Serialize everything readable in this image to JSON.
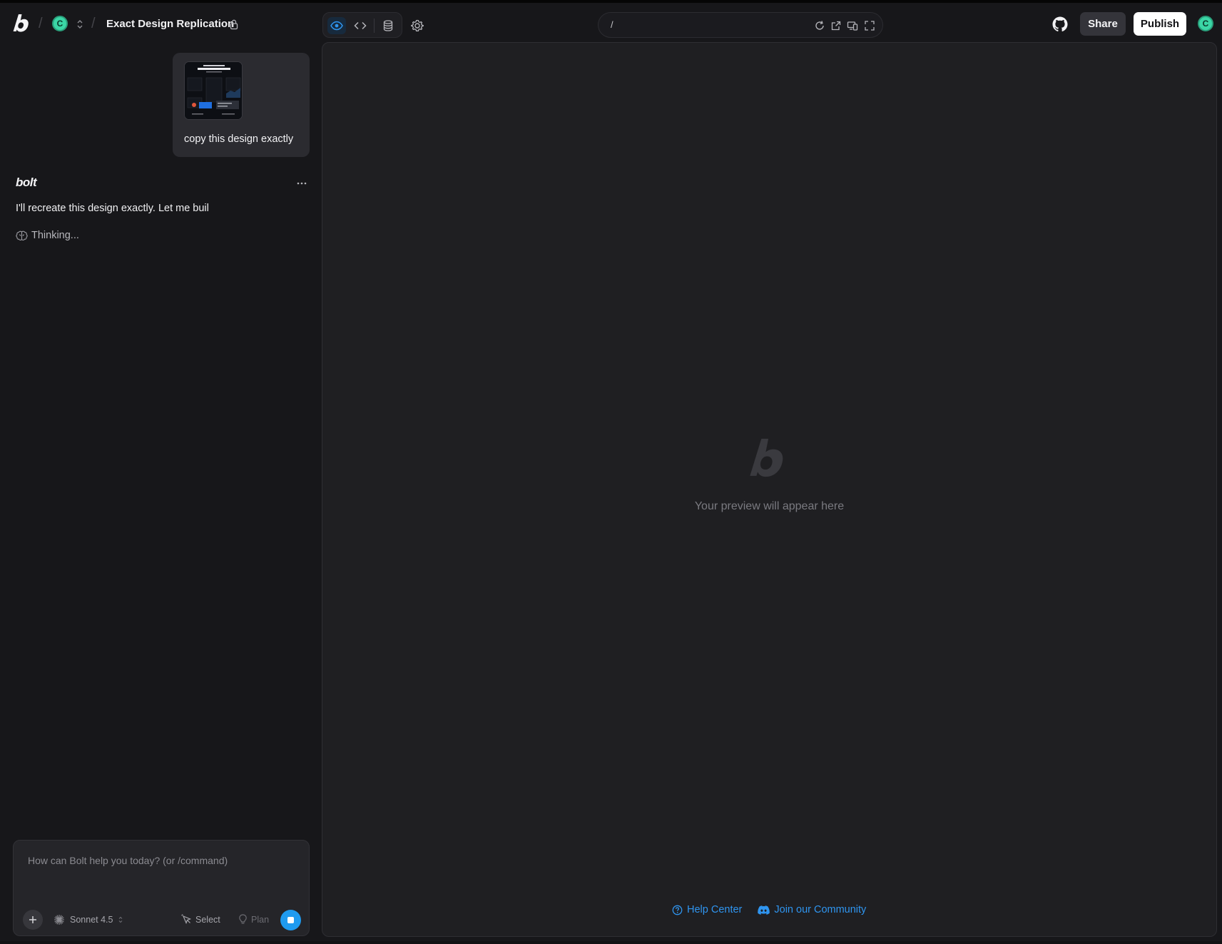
{
  "header": {
    "user_initial": "C",
    "project_title": "Exact Design Replication",
    "url_path": "/",
    "share_label": "Share",
    "publish_label": "Publish",
    "account_initial": "C"
  },
  "chat": {
    "user_message": "copy this design exactly",
    "assistant_name": "bolt",
    "assistant_message": "I'll recreate this design exactly. Let me buil",
    "thinking_label": "Thinking..."
  },
  "composer": {
    "placeholder": "How can Bolt help you today? (or /command)",
    "model_label": "Sonnet 4.5",
    "select_label": "Select",
    "plan_label": "Plan"
  },
  "preview": {
    "empty_text": "Your preview will appear here",
    "help_center_label": "Help Center",
    "community_label": "Join our Community"
  },
  "colors": {
    "accent": "#1f9bf0",
    "link": "#2f95f0",
    "avatar": "#3bd6a6"
  }
}
